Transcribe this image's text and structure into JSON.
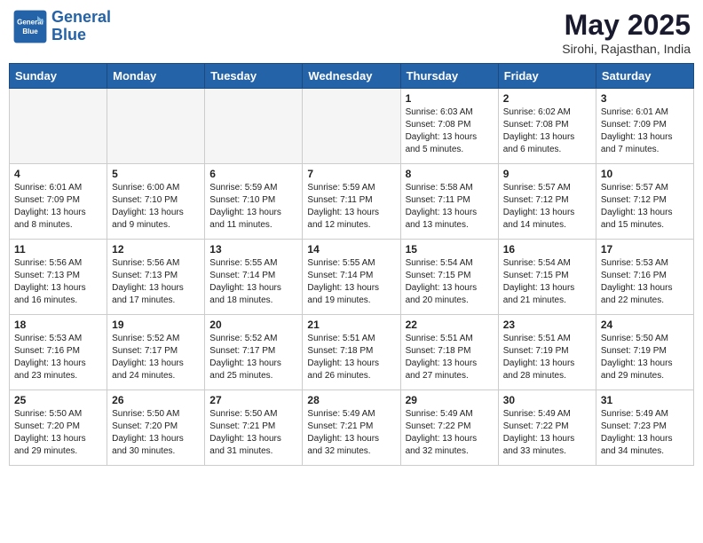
{
  "header": {
    "logo_line1": "General",
    "logo_line2": "Blue",
    "month": "May 2025",
    "location": "Sirohi, Rajasthan, India"
  },
  "weekdays": [
    "Sunday",
    "Monday",
    "Tuesday",
    "Wednesday",
    "Thursday",
    "Friday",
    "Saturday"
  ],
  "weeks": [
    [
      {
        "day": "",
        "content": ""
      },
      {
        "day": "",
        "content": ""
      },
      {
        "day": "",
        "content": ""
      },
      {
        "day": "",
        "content": ""
      },
      {
        "day": "1",
        "content": "Sunrise: 6:03 AM\nSunset: 7:08 PM\nDaylight: 13 hours\nand 5 minutes."
      },
      {
        "day": "2",
        "content": "Sunrise: 6:02 AM\nSunset: 7:08 PM\nDaylight: 13 hours\nand 6 minutes."
      },
      {
        "day": "3",
        "content": "Sunrise: 6:01 AM\nSunset: 7:09 PM\nDaylight: 13 hours\nand 7 minutes."
      }
    ],
    [
      {
        "day": "4",
        "content": "Sunrise: 6:01 AM\nSunset: 7:09 PM\nDaylight: 13 hours\nand 8 minutes."
      },
      {
        "day": "5",
        "content": "Sunrise: 6:00 AM\nSunset: 7:10 PM\nDaylight: 13 hours\nand 9 minutes."
      },
      {
        "day": "6",
        "content": "Sunrise: 5:59 AM\nSunset: 7:10 PM\nDaylight: 13 hours\nand 11 minutes."
      },
      {
        "day": "7",
        "content": "Sunrise: 5:59 AM\nSunset: 7:11 PM\nDaylight: 13 hours\nand 12 minutes."
      },
      {
        "day": "8",
        "content": "Sunrise: 5:58 AM\nSunset: 7:11 PM\nDaylight: 13 hours\nand 13 minutes."
      },
      {
        "day": "9",
        "content": "Sunrise: 5:57 AM\nSunset: 7:12 PM\nDaylight: 13 hours\nand 14 minutes."
      },
      {
        "day": "10",
        "content": "Sunrise: 5:57 AM\nSunset: 7:12 PM\nDaylight: 13 hours\nand 15 minutes."
      }
    ],
    [
      {
        "day": "11",
        "content": "Sunrise: 5:56 AM\nSunset: 7:13 PM\nDaylight: 13 hours\nand 16 minutes."
      },
      {
        "day": "12",
        "content": "Sunrise: 5:56 AM\nSunset: 7:13 PM\nDaylight: 13 hours\nand 17 minutes."
      },
      {
        "day": "13",
        "content": "Sunrise: 5:55 AM\nSunset: 7:14 PM\nDaylight: 13 hours\nand 18 minutes."
      },
      {
        "day": "14",
        "content": "Sunrise: 5:55 AM\nSunset: 7:14 PM\nDaylight: 13 hours\nand 19 minutes."
      },
      {
        "day": "15",
        "content": "Sunrise: 5:54 AM\nSunset: 7:15 PM\nDaylight: 13 hours\nand 20 minutes."
      },
      {
        "day": "16",
        "content": "Sunrise: 5:54 AM\nSunset: 7:15 PM\nDaylight: 13 hours\nand 21 minutes."
      },
      {
        "day": "17",
        "content": "Sunrise: 5:53 AM\nSunset: 7:16 PM\nDaylight: 13 hours\nand 22 minutes."
      }
    ],
    [
      {
        "day": "18",
        "content": "Sunrise: 5:53 AM\nSunset: 7:16 PM\nDaylight: 13 hours\nand 23 minutes."
      },
      {
        "day": "19",
        "content": "Sunrise: 5:52 AM\nSunset: 7:17 PM\nDaylight: 13 hours\nand 24 minutes."
      },
      {
        "day": "20",
        "content": "Sunrise: 5:52 AM\nSunset: 7:17 PM\nDaylight: 13 hours\nand 25 minutes."
      },
      {
        "day": "21",
        "content": "Sunrise: 5:51 AM\nSunset: 7:18 PM\nDaylight: 13 hours\nand 26 minutes."
      },
      {
        "day": "22",
        "content": "Sunrise: 5:51 AM\nSunset: 7:18 PM\nDaylight: 13 hours\nand 27 minutes."
      },
      {
        "day": "23",
        "content": "Sunrise: 5:51 AM\nSunset: 7:19 PM\nDaylight: 13 hours\nand 28 minutes."
      },
      {
        "day": "24",
        "content": "Sunrise: 5:50 AM\nSunset: 7:19 PM\nDaylight: 13 hours\nand 29 minutes."
      }
    ],
    [
      {
        "day": "25",
        "content": "Sunrise: 5:50 AM\nSunset: 7:20 PM\nDaylight: 13 hours\nand 29 minutes."
      },
      {
        "day": "26",
        "content": "Sunrise: 5:50 AM\nSunset: 7:20 PM\nDaylight: 13 hours\nand 30 minutes."
      },
      {
        "day": "27",
        "content": "Sunrise: 5:50 AM\nSunset: 7:21 PM\nDaylight: 13 hours\nand 31 minutes."
      },
      {
        "day": "28",
        "content": "Sunrise: 5:49 AM\nSunset: 7:21 PM\nDaylight: 13 hours\nand 32 minutes."
      },
      {
        "day": "29",
        "content": "Sunrise: 5:49 AM\nSunset: 7:22 PM\nDaylight: 13 hours\nand 32 minutes."
      },
      {
        "day": "30",
        "content": "Sunrise: 5:49 AM\nSunset: 7:22 PM\nDaylight: 13 hours\nand 33 minutes."
      },
      {
        "day": "31",
        "content": "Sunrise: 5:49 AM\nSunset: 7:23 PM\nDaylight: 13 hours\nand 34 minutes."
      }
    ]
  ]
}
